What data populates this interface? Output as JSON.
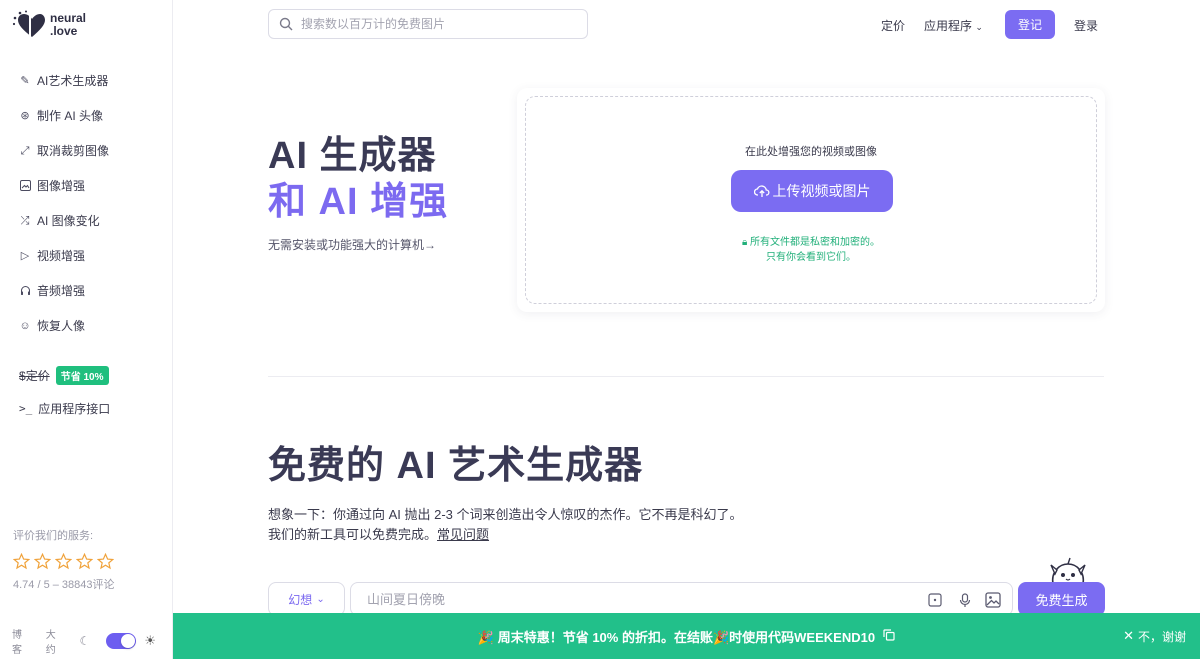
{
  "brand": {
    "name_line1": "neural",
    "name_line2": ".love"
  },
  "search": {
    "placeholder": "搜索数以百万计的免费图片",
    "icon": "search-icon"
  },
  "header": {
    "pricing": "定价",
    "apps": "应用程序",
    "signup": "登记",
    "login": "登录"
  },
  "sidebar": {
    "items": [
      {
        "label": "AI艺术生成器",
        "icon": "feather-icon"
      },
      {
        "label": "制作 AI 头像",
        "icon": "aperture-icon"
      },
      {
        "label": "取消裁剪图像",
        "icon": "expand-icon"
      },
      {
        "label": "图像增强",
        "icon": "image-icon"
      },
      {
        "label": "AI 图像变化",
        "icon": "shuffle-icon"
      },
      {
        "label": "视频增强",
        "icon": "play-icon"
      },
      {
        "label": "音频增强",
        "icon": "headphones-icon"
      },
      {
        "label": "恢复人像",
        "icon": "smile-icon"
      }
    ],
    "pricing_label": "定价",
    "pricing_badge": "节省 10%",
    "api_label": "应用程序接口"
  },
  "rating": {
    "title": "评价我们的服务:",
    "score_text": "4.74 / 5 – 38843评论",
    "stars": 5
  },
  "footer": {
    "blog": "博客",
    "about": "大约"
  },
  "hero": {
    "title_line1": "AI 生成器",
    "title_line2": "和 AI 增强",
    "subtitle": "无需安装或功能强大的计算机→"
  },
  "upload": {
    "title": "在此处增强您的视频或图像",
    "button": "上传视频或图片",
    "privacy_line1": "所有文件都是私密和加密的。",
    "privacy_line2": "只有你会看到它们。"
  },
  "art": {
    "title": "免费的 AI 艺术生成器",
    "desc_line1": "想象一下：你通过向 AI 抛出 2-3 个词来创造出令人惊叹的杰作。它不再是科幻了。",
    "desc_line2": "我们的新工具可以免费完成。",
    "faq": "常见问题",
    "style_value": "幻想",
    "prompt_placeholder": "山间夏日傍晚",
    "generate": "免费生成"
  },
  "promo": {
    "text": "🎉 周末特惠！节省 10% 的折扣。在结账🎉时使用代码WEEKEND10",
    "close": "不，谢谢"
  },
  "colors": {
    "accent": "#7b6cf2",
    "promo": "#22c08a",
    "badge": "#1fbf7e",
    "star": "#f0a23a"
  }
}
